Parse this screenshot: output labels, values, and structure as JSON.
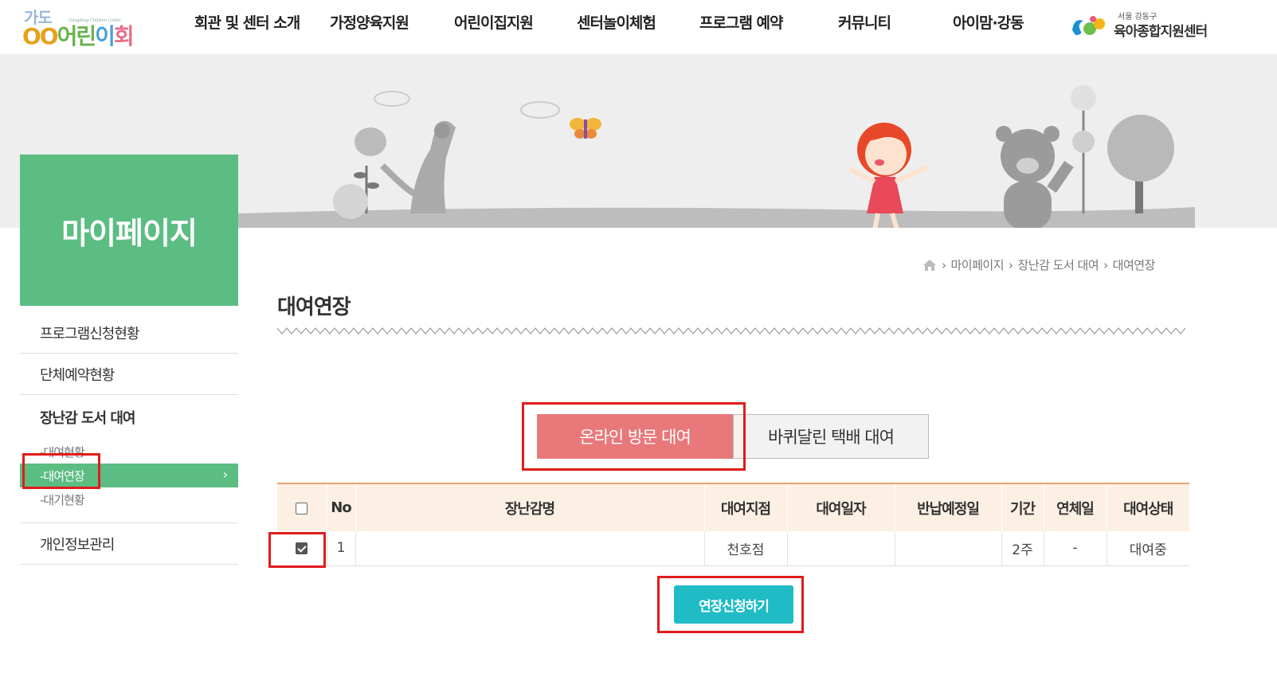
{
  "header": {
    "logo": {
      "top": "가도",
      "main": [
        "OO",
        "어린",
        "이",
        "회관"
      ],
      "sub": "Gangdong Children Center"
    },
    "nav": [
      "회관 및 센터 소개",
      "가정양육지원",
      "어린이집지원",
      "센터놀이체험",
      "프로그램 예약",
      "커뮤니티",
      "아이맘·강동"
    ],
    "partner": {
      "small": "서울 강동구",
      "big": "육아종합지원센터"
    }
  },
  "sidebar": {
    "title": "마이페이지",
    "items": [
      {
        "label": "프로그램신청현황"
      },
      {
        "label": "단체예약현황"
      }
    ],
    "group": {
      "title": "장난감 도서 대여",
      "subitems": [
        {
          "label": "-대여현황"
        },
        {
          "label": "-대여연장"
        },
        {
          "label": "-대기현황"
        }
      ]
    },
    "last": {
      "label": "개인정보관리"
    }
  },
  "breadcrumb": [
    "마이페이지",
    "장난감 도서 대여",
    "대여연장"
  ],
  "page_title": "대여연장",
  "tabs": [
    {
      "label": "온라인 방문 대여",
      "active": true
    },
    {
      "label": "바퀴달린 택배 대여",
      "active": false
    }
  ],
  "table": {
    "headers": [
      "No",
      "장난감명",
      "대여지점",
      "대여일자",
      "반납예정일",
      "기간",
      "연체일",
      "대여상태"
    ],
    "rows": [
      {
        "checked": true,
        "no": "1",
        "name": "",
        "branch": "천호점",
        "rent_date": "",
        "return_date": "",
        "period": "2주",
        "overdue": "-",
        "status": "대여중"
      }
    ]
  },
  "extend_button": "연장신청하기",
  "colors": {
    "green": "#5cbd83",
    "tab_active": "#e9787a",
    "button": "#1fbcc6",
    "highlight": "#e01c1c"
  }
}
